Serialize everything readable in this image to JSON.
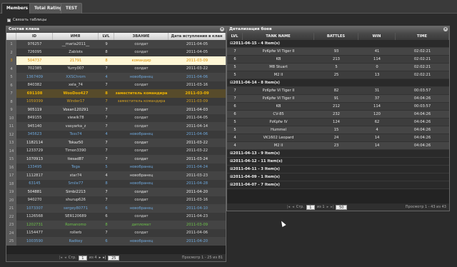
{
  "tabs": [
    {
      "label": "Members"
    },
    {
      "label": "Total Rating"
    },
    {
      "label": "TEST"
    }
  ],
  "link_tables": {
    "label": "Связать таблицы"
  },
  "left": {
    "title": "Состав клана",
    "columns": [
      "ID",
      "ИМЯ",
      "LVL",
      "ЗВАНИЕ",
      "Дата вступления в клан"
    ],
    "rows": [
      {
        "n": "1",
        "id": "976257",
        "name": "__maria2011__",
        "lvl": "9",
        "rank": "солдат",
        "date": "2011-04-05",
        "c": "#ddd"
      },
      {
        "n": "2",
        "id": "726095",
        "name": "Zablots",
        "lvl": "8",
        "rank": "солдат",
        "date": "2011-04-05",
        "c": "#ddd"
      },
      {
        "n": "3",
        "id": "504737",
        "name": "21791",
        "lvl": "8",
        "rank": "командир",
        "date": "2011-03-09",
        "c": "#d98f00",
        "hl": true
      },
      {
        "n": "4",
        "id": "702385",
        "name": "Yurry007",
        "lvl": "7",
        "rank": "солдат",
        "date": "2011-03-22",
        "c": "#ddd"
      },
      {
        "n": "5",
        "id": "1367409",
        "name": "XXSChrom",
        "lvl": "4",
        "rank": "новобранец",
        "date": "2011-04-06",
        "c": "#6fa8dc"
      },
      {
        "n": "6",
        "id": "840382",
        "name": "xela_74",
        "lvl": "7",
        "rank": "солдат",
        "date": "2011-03-16",
        "c": "#ddd"
      },
      {
        "n": "7",
        "id": "691108",
        "name": "WooDoo427",
        "lvl": "8",
        "rank": "заместитель командира",
        "date": "2011-03-09",
        "c": "#f0b400",
        "sel": true
      },
      {
        "n": "8",
        "id": "1059399",
        "name": "Winder17",
        "lvl": "7",
        "rank": "заместитель командира",
        "date": "2011-03-09",
        "c": "#d4a020"
      },
      {
        "n": "9",
        "id": "905119",
        "name": "Voxan120291",
        "lvl": "7",
        "rank": "солдат",
        "date": "2011-04-03",
        "c": "#eee"
      },
      {
        "n": "10",
        "id": "849155",
        "name": "viewik78",
        "lvl": "7",
        "rank": "солдат",
        "date": "2011-04-05",
        "c": "#ddd"
      },
      {
        "n": "11",
        "id": "945140",
        "name": "vasyarka_z",
        "lvl": "7",
        "rank": "солдат",
        "date": "2011-04-14",
        "c": "#ddd"
      },
      {
        "n": "12",
        "id": "345623",
        "name": "Tsss74",
        "lvl": "4",
        "rank": "новобранец",
        "date": "2011-04-06",
        "c": "#6fa8dc"
      },
      {
        "n": "13",
        "id": "1182114",
        "name": "Tokaz50",
        "lvl": "7",
        "rank": "солдат",
        "date": "2011-03-22",
        "c": "#eee"
      },
      {
        "n": "14",
        "id": "1233729",
        "name": "Timon3390",
        "lvl": "7",
        "rank": "солдат",
        "date": "2011-03-22",
        "c": "#ddd"
      },
      {
        "n": "15",
        "id": "1070913",
        "name": "tiesad87",
        "lvl": "7",
        "rank": "солдат",
        "date": "2011-03-24",
        "c": "#eee"
      },
      {
        "n": "16",
        "id": "133495",
        "name": "Tega",
        "lvl": "5",
        "rank": "новобранец",
        "date": "2011-04-24",
        "c": "#6fa8dc"
      },
      {
        "n": "17",
        "id": "1112817",
        "name": "star74",
        "lvl": "4",
        "rank": "новобранец",
        "date": "2011-03-23",
        "c": "#ddd"
      },
      {
        "n": "18",
        "id": "63145",
        "name": "Smile77",
        "lvl": "8",
        "rank": "новобранец",
        "date": "2011-04-28",
        "c": "#6fa8dc"
      },
      {
        "n": "19",
        "id": "504881",
        "name": "Simbi2213",
        "lvl": "7",
        "rank": "солдат",
        "date": "2011-04-20",
        "c": "#eee"
      },
      {
        "n": "20",
        "id": "940270",
        "name": "shurup626",
        "lvl": "7",
        "rank": "солдат",
        "date": "2011-03-16",
        "c": "#ddd"
      },
      {
        "n": "21",
        "id": "1073307",
        "name": "sergey80771",
        "lvl": "6",
        "rank": "новобранец",
        "date": "2011-04-10",
        "c": "#6fa8dc"
      },
      {
        "n": "22",
        "id": "1126568",
        "name": "SER120689",
        "lvl": "6",
        "rank": "солдат",
        "date": "2011-04-23",
        "c": "#ddd"
      },
      {
        "n": "23",
        "id": "1202731",
        "name": "Romanomo",
        "lvl": "8",
        "rank": "дипломат",
        "date": "2011-03-09",
        "c": "#6cc04a"
      },
      {
        "n": "24",
        "id": "1154477",
        "name": "rollerb",
        "lvl": "7",
        "rank": "солдат",
        "date": "2011-04-06",
        "c": "#ddd"
      },
      {
        "n": "25",
        "id": "1003590",
        "name": "Radkey",
        "lvl": "6",
        "rank": "новобранец",
        "date": "2011-04-20",
        "c": "#6fa8dc"
      }
    ],
    "pager": {
      "page_label": "Стр.",
      "page": "1",
      "of": "из 4",
      "size": "25",
      "summary": "Просмотр 1 - 25 из 81"
    }
  },
  "right": {
    "title": "Детализация боев",
    "columns": [
      "LVL",
      "TANK NAME",
      "BATTLES",
      "WIN",
      "TIME"
    ],
    "groups": [
      {
        "label": "2011-04-15 - 4 Item(s)",
        "open": true,
        "rows": [
          {
            "lvl": "7",
            "tank": "PzKpfw VI Tiger II",
            "battles": "93",
            "win": "41",
            "time": "02:02:21"
          },
          {
            "lvl": "6",
            "tank": "KB",
            "battles": "213",
            "win": "114",
            "time": "02:02:21"
          },
          {
            "lvl": "5",
            "tank": "M8 Stuart",
            "battles": "5",
            "win": "0",
            "time": "02:02:21"
          },
          {
            "lvl": "5",
            "tank": "M2 II",
            "battles": "25",
            "win": "13",
            "time": "02:02:21"
          }
        ]
      },
      {
        "label": "2011-04-14 - 8 Item(s)",
        "open": true,
        "rows": [
          {
            "lvl": "7",
            "tank": "PzKpfw VI Tiger II",
            "battles": "82",
            "win": "31",
            "time": "00:03:57"
          },
          {
            "lvl": "7",
            "tank": "PzKpfw VI Tiger II",
            "battles": "91",
            "win": "37",
            "time": "04:04:26"
          },
          {
            "lvl": "6",
            "tank": "KB",
            "battles": "212",
            "win": "114",
            "time": "00:03:57"
          },
          {
            "lvl": "6",
            "tank": "CV-85",
            "battles": "232",
            "win": "120",
            "time": "04:04:26"
          },
          {
            "lvl": "5",
            "tank": "PzKpfw IV",
            "battles": "124",
            "win": "62",
            "time": "04:04:26"
          },
          {
            "lvl": "5",
            "tank": "Hummel",
            "battles": "15",
            "win": "4",
            "time": "04:04:26"
          },
          {
            "lvl": "4",
            "tank": "VK1602 Leopard",
            "battles": "24",
            "win": "14",
            "time": "04:04:26"
          },
          {
            "lvl": "4",
            "tank": "M2 II",
            "battles": "23",
            "win": "14",
            "time": "04:04:26"
          }
        ]
      },
      {
        "label": "2011-04-13 - 9 Item(s)",
        "open": false,
        "rows": []
      },
      {
        "label": "2011-04-12 - 11 Item(s)",
        "open": false,
        "rows": []
      },
      {
        "label": "2011-04-11 - 3 Item(s)",
        "open": false,
        "rows": []
      },
      {
        "label": "2011-04-09 - 1 Item(s)",
        "open": false,
        "rows": []
      },
      {
        "label": "2011-04-07 - 7 Item(s)",
        "open": false,
        "rows": []
      }
    ],
    "pager": {
      "page_label": "Стр.",
      "page": "1",
      "of": "из 1",
      "size": "50",
      "summary": "Просмотр 1 - 43 из 43"
    }
  }
}
